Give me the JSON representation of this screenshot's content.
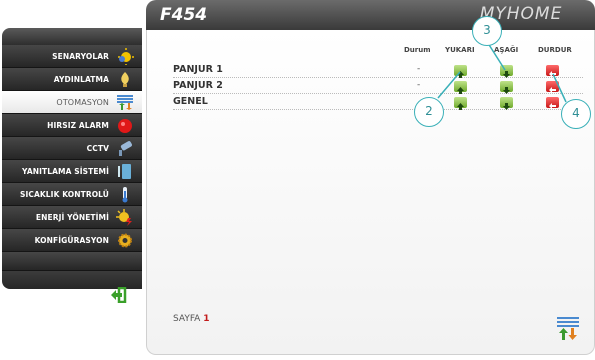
{
  "header": {
    "title": "F454",
    "logo": "MYHOME"
  },
  "sidebar": {
    "items": [
      {
        "label": "SENARYOLAR",
        "icon": "sun-icon"
      },
      {
        "label": "AYDINLATMA",
        "icon": "lightbulb-icon"
      },
      {
        "label": "OTOMASYON",
        "icon": "shutter-icon",
        "active": true
      },
      {
        "label": "HIRSIZ ALARM",
        "icon": "alarm-icon"
      },
      {
        "label": "CCTV",
        "icon": "camera-icon"
      },
      {
        "label": "YANITLAMA SİSTEMİ",
        "icon": "intercom-icon"
      },
      {
        "label": "SICAKLIK KONTROLÜ",
        "icon": "thermometer-icon"
      },
      {
        "label": "ENERJİ YÖNETİMİ",
        "icon": "energy-icon"
      },
      {
        "label": "KONFİGÜRASYON",
        "icon": "gear-icon"
      }
    ],
    "back_icon": "back-arrow-icon"
  },
  "table": {
    "columns": [
      "Durum",
      "YUKARI",
      "AŞAĞI",
      "DURDUR"
    ],
    "rows": [
      {
        "label": "PANJUR 1",
        "status": "-"
      },
      {
        "label": "PANJUR 2",
        "status": "-"
      },
      {
        "label": "GENEL",
        "status": ""
      }
    ]
  },
  "callouts": [
    "2",
    "3",
    "4"
  ],
  "footer": {
    "page_label": "SAYFA",
    "page_number": "1"
  },
  "colors": {
    "header": "#4a4a4a",
    "up_button": "#6faa2c",
    "stop_button": "#c81818",
    "callout": "#3ab0b8"
  }
}
